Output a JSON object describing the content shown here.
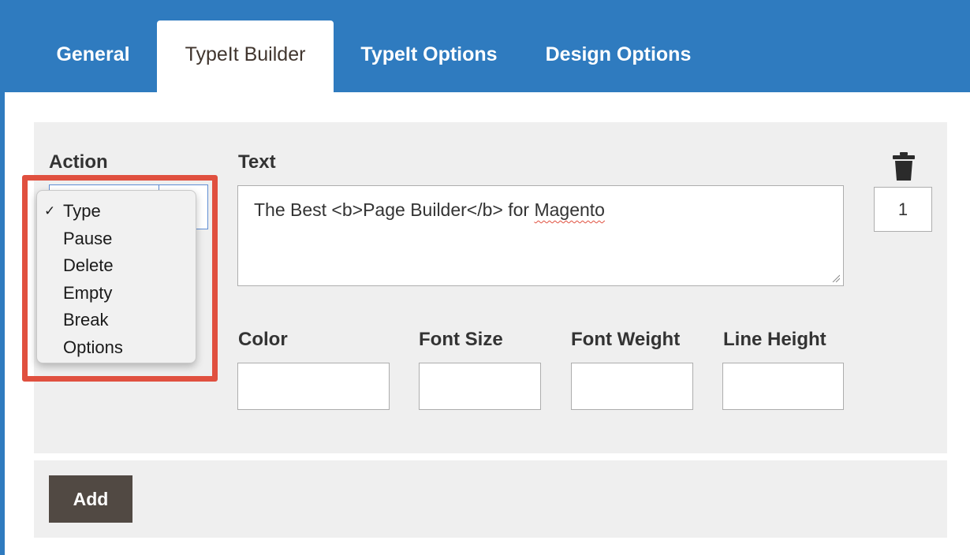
{
  "tabs": [
    {
      "label": "General",
      "active": false
    },
    {
      "label": "TypeIt Builder",
      "active": true
    },
    {
      "label": "TypeIt Options",
      "active": false
    },
    {
      "label": "Design Options",
      "active": false
    }
  ],
  "form": {
    "action_label": "Action",
    "text_label": "Text",
    "text_value_prefix": "The Best <b>Page Builder</b> for ",
    "text_value_misspelled": "Magento",
    "color_label": "Color",
    "font_size_label": "Font Size",
    "font_weight_label": "Font Weight",
    "line_height_label": "Line Height",
    "order_value": "1"
  },
  "dropdown": {
    "check_mark": "✓",
    "options": [
      "Type",
      "Pause",
      "Delete",
      "Empty",
      "Break",
      "Options"
    ],
    "selected": "Type"
  },
  "add_button_label": "Add",
  "colors": {
    "header_blue": "#2f7bbf",
    "highlight_red": "#e0503f",
    "button_dark": "#514943",
    "panel_gray": "#efefef"
  },
  "icons": {
    "delete": "trash-icon",
    "resize": "resize-grip-icon",
    "selected": "check-icon"
  }
}
